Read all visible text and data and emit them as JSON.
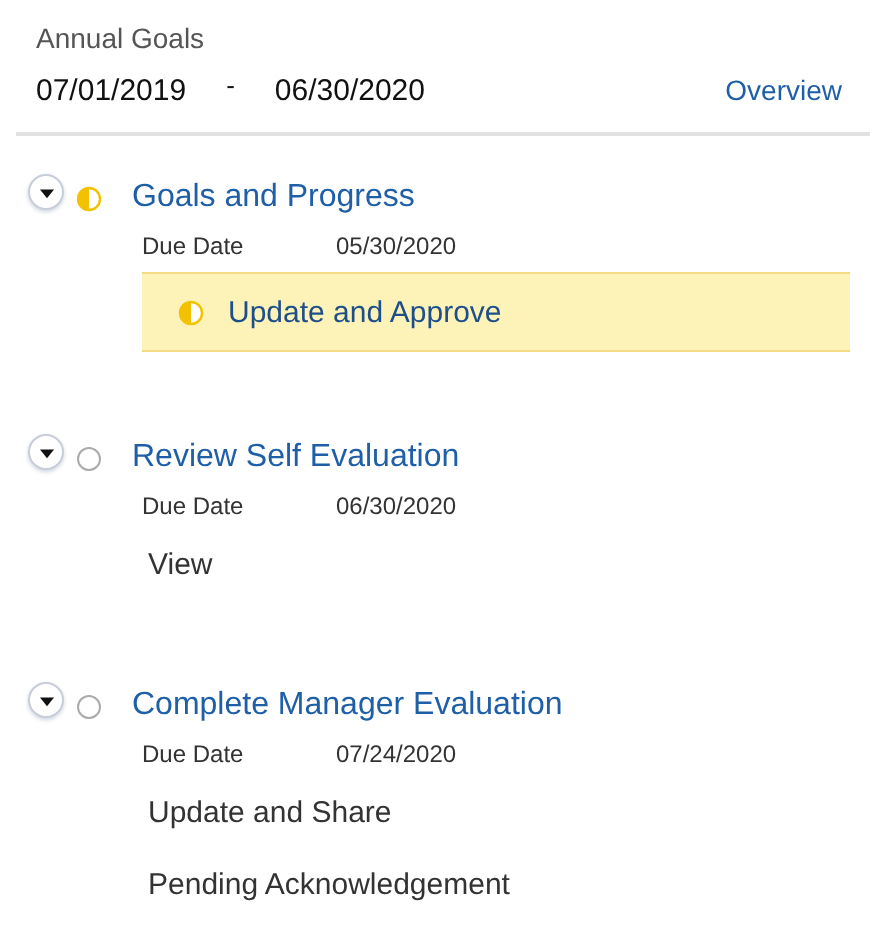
{
  "header": {
    "title": "Annual Goals",
    "start_date": "07/01/2019",
    "separator": "-",
    "end_date": "06/30/2020",
    "link": "Overview"
  },
  "steps": [
    {
      "title": "Goals and Progress",
      "kind": "partial",
      "expanded": true,
      "due_label": "Due Date",
      "due_date": "05/30/2020",
      "actions": [
        {
          "label": "Update and Approve",
          "kind": "current"
        }
      ]
    },
    {
      "title": "Review Self Evaluation",
      "kind": "empty",
      "expanded": true,
      "due_label": "Due Date",
      "due_date": "06/30/2020",
      "actions": [
        {
          "label": "View",
          "kind": "plain"
        }
      ]
    },
    {
      "title": "Complete Manager Evaluation",
      "kind": "empty",
      "expanded": true,
      "due_label": "Due Date",
      "due_date": "07/24/2020",
      "actions": [
        {
          "label": "Update and Share",
          "kind": "plain"
        },
        {
          "label": "Pending Acknowledgement",
          "kind": "plain"
        }
      ]
    }
  ]
}
